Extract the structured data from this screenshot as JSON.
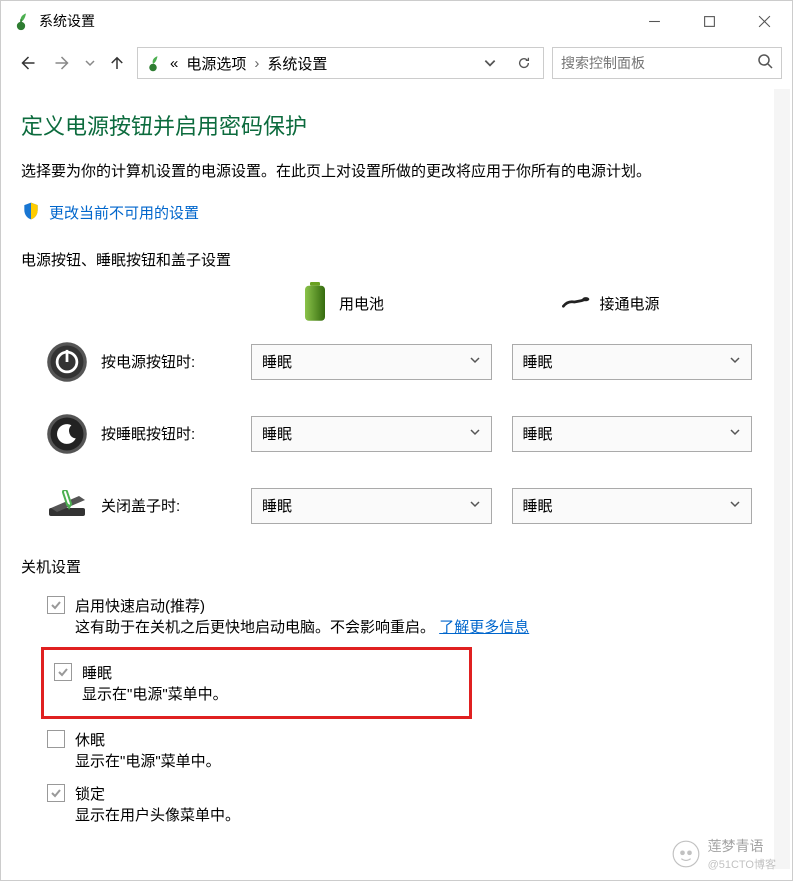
{
  "window": {
    "title": "系统设置"
  },
  "nav": {
    "crumb1": "«",
    "crumb2": "电源选项",
    "crumb3": "系统设置"
  },
  "search": {
    "placeholder": "搜索控制面板"
  },
  "page": {
    "heading": "定义电源按钮并启用密码保护",
    "description": "选择要为你的计算机设置的电源设置。在此页上对设置所做的更改将应用于你所有的电源计划。",
    "shield_link": "更改当前不可用的设置",
    "section1_label": "电源按钮、睡眠按钮和盖子设置",
    "battery_label": "用电池",
    "plugged_label": "接通电源",
    "rows": {
      "power_button_label": "按电源按钮时:",
      "sleep_button_label": "按睡眠按钮时:",
      "lid_label": "关闭盖子时:",
      "value": "睡眠"
    },
    "section2_label": "关机设置",
    "shutdown": {
      "fast_label": "启用快速启动(推荐)",
      "fast_sub_a": "这有助于在关机之后更快地启动电脑。不会影响重启。",
      "fast_link": "了解更多信息",
      "sleep_label": "睡眠",
      "sleep_sub": "显示在\"电源\"菜单中。",
      "hibernate_label": "休眠",
      "hibernate_sub": "显示在\"电源\"菜单中。",
      "lock_label": "锁定",
      "lock_sub": "显示在用户头像菜单中。"
    }
  },
  "watermark": {
    "name": "莲梦青语",
    "sub": "@51CTO博客"
  }
}
